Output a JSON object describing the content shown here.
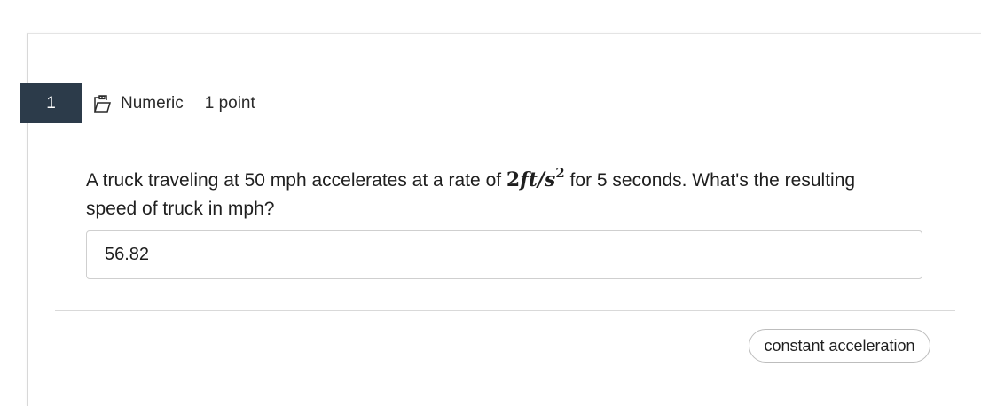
{
  "question": {
    "number": "1",
    "type_icon": "numeric-question-icon",
    "type_label": "Numeric",
    "points": "1 point",
    "text_before": "A truck traveling at 50 mph accelerates at a rate of ",
    "math_coefficient": "2",
    "math_units": "ft/s",
    "math_exponent": "2",
    "text_after": " for 5 seconds. What's the resulting speed of truck in mph?",
    "answer_value": "56.82"
  },
  "tags": [
    "constant acceleration"
  ],
  "colors": {
    "number_badge_bg": "#2c3b4a",
    "number_badge_text": "#ffffff",
    "border": "#cfcfcf"
  }
}
